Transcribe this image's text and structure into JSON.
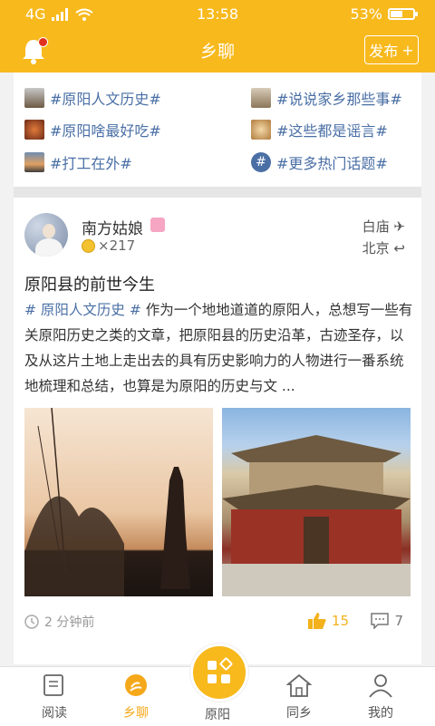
{
  "status": {
    "network": "4G",
    "time": "13:58",
    "battery": "53%",
    "battery_level": 0.53
  },
  "header": {
    "title": "乡聊",
    "publish_label": "发布"
  },
  "topics": [
    {
      "label": "#原阳人文历史#"
    },
    {
      "label": "#说说家乡那些事#"
    },
    {
      "label": "#原阳啥最好吃#"
    },
    {
      "label": "#这些都是谣言#"
    },
    {
      "label": "#打工在外#"
    },
    {
      "label": "#更多热门话题#"
    }
  ],
  "post": {
    "username": "南方姑娘",
    "coins": "×217",
    "from": "白庙",
    "to": "北京",
    "title": "原阳县的前世今生",
    "tag": "# 原阳人文历史 #",
    "body": " 作为一个地地道道的原阳人，总想写一些有关原阳历史之类的文章，把原阳县的历史沿革，古迹圣存，以及从这片土地上走出去的具有历史影响力的人物进行一番系统地梳理和总结，也算是为原阳的历史与文 ...",
    "time": "2 分钟前",
    "likes": "15",
    "comments": "7"
  },
  "tabs": [
    {
      "label": "阅读"
    },
    {
      "label": "乡聊"
    },
    {
      "label": "原阳"
    },
    {
      "label": "同乡"
    },
    {
      "label": "我的"
    }
  ],
  "colors": {
    "accent": "#f8b91d",
    "link": "#4a6fa5"
  }
}
